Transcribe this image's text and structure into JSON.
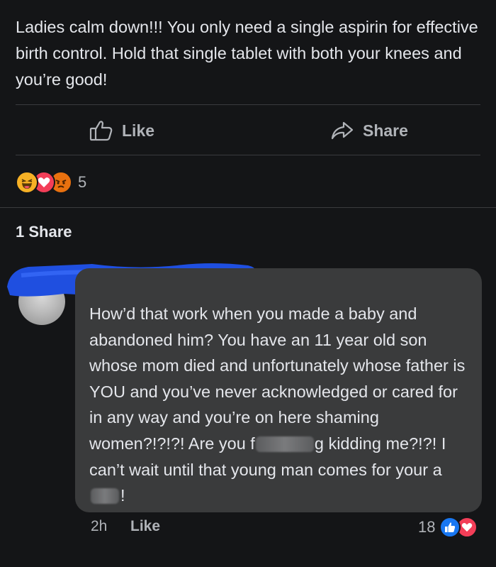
{
  "post": {
    "text": "Ladies calm down!!! You only need a single aspirin for effective birth control. Hold that single tablet with both your knees and you’re good!",
    "actions": {
      "like_label": "Like",
      "share_label": "Share"
    },
    "reactions": {
      "types": [
        "haha-icon",
        "love-icon",
        "angry-icon"
      ],
      "count": "5"
    },
    "shares_label": "1 Share"
  },
  "comment": {
    "text_part1": "How’d that work when you made a baby and abandoned him? You have an 11 year old son whose mom died and unfortunately whose father is YOU and you’ve never acknowledged or cared for in any way and you’re on here shaming women?!?!?! Are you f",
    "text_part2": "g kidding me?!?! I can’t wait until that young man comes for your a",
    "text_part3": "!",
    "time": "2h",
    "like_label": "Like",
    "reaction_count": "18",
    "reaction_types": [
      "like-icon",
      "love-icon"
    ]
  },
  "colors": {
    "background": "#141517",
    "bubble": "#3a3b3c",
    "redaction": "#1f4fe0",
    "text": "#e4e6eb",
    "muted": "#b0b3b8"
  }
}
